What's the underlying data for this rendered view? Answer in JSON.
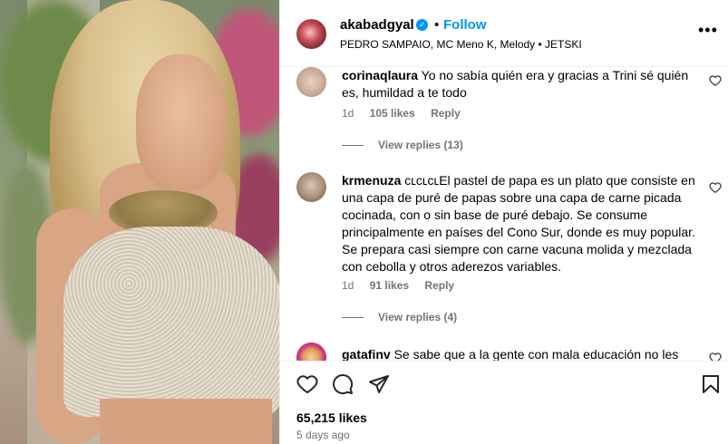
{
  "post": {
    "username": "akabadgyal",
    "follow_label": "Follow",
    "separator": "•",
    "audio": "PEDRO SAMPAIO, MC Meno K, Melody • JETSKI",
    "more_label": "•••",
    "likes": "65,215 likes",
    "time_ago": "5 days ago"
  },
  "comments": [
    {
      "username": "corinaqlaura",
      "text": "Yo no sabía quién era y gracias a Trini sé quién es, humildad a te todo",
      "age": "1d",
      "likes": "105 likes",
      "reply": "Reply",
      "view_replies": "View replies (13)"
    },
    {
      "username": "krmenuza",
      "text": "ᴄʟᴄʟᴄʟEl pastel de papa es un plato que consiste en una capa de puré de papas sobre una capa de carne picada cocinada, con o sin base de puré debajo. Se consume principalmente en países del Cono Sur, donde es muy popular. Se prepara casi siempre con carne vacuna molida y mezclada con cebolla y otros aderezos variables.",
      "age": "1d",
      "likes": "91 likes",
      "reply": "Reply",
      "view_replies": "View replies (4)"
    },
    {
      "username": "gatafinv",
      "text": "Se sabe que a la gente con mala educación no les das"
    }
  ],
  "colors": {
    "accent": "#0095f6",
    "muted": "#737373",
    "divider": "#efefef"
  },
  "icons": [
    "heart-icon",
    "comment-icon",
    "share-icon",
    "bookmark-icon",
    "more-icon",
    "verified-icon"
  ]
}
